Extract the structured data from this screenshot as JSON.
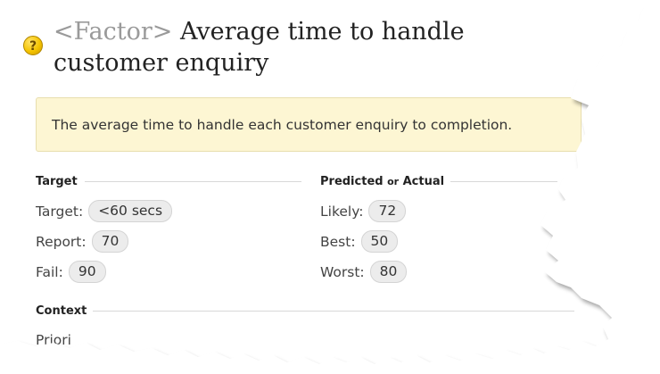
{
  "header": {
    "kind_label": "<Factor>",
    "title": "Average time to handle customer enquiry"
  },
  "description": "The average time to handle each customer enquiry to completion.",
  "target_section": {
    "heading": "Target",
    "rows": [
      {
        "label": "Target:",
        "value": "<60 secs"
      },
      {
        "label": "Report:",
        "value": "70"
      },
      {
        "label": "Fail:",
        "value": "90"
      }
    ]
  },
  "predicted_section": {
    "heading_a": "Predicted",
    "heading_or": "or",
    "heading_b": "Actual",
    "rows": [
      {
        "label": "Likely:",
        "value": "72"
      },
      {
        "label": "Best:",
        "value": "50"
      },
      {
        "label": "Worst:",
        "value": "80"
      }
    ]
  },
  "context_section": {
    "heading": "Context",
    "partial_row_label": "Priori"
  },
  "icons": {
    "help": "help-icon"
  },
  "colors": {
    "description_bg": "#fdf6d3",
    "help_icon": "#f5c400"
  }
}
